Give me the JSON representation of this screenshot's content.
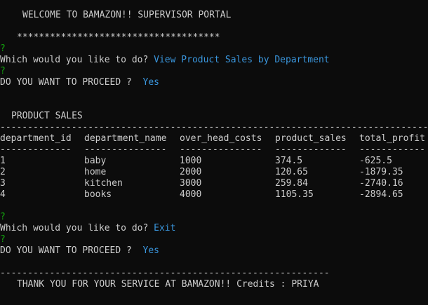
{
  "colors": {
    "background": "#0c0c0c",
    "text": "#cccccc",
    "prompt_mark": "#13a10e",
    "answer": "#3a96dd"
  },
  "header": {
    "welcome": "WELCOME TO BAMAZON!! SUPERVISOR PORTAL",
    "stars": "*************************************"
  },
  "session1": {
    "question_mark": "?",
    "question": "Which would you like to do?",
    "answer": "View Product Sales by Department",
    "proceed_mark": "?",
    "proceed_question": "DO YOU WANT TO PROCEED ?",
    "proceed_answer": "Yes"
  },
  "sales": {
    "title": "PRODUCT SALES",
    "top_separator": "--------------------------------------------------------------------------------",
    "columns": [
      "department_id",
      "department_name",
      "over_head_costs",
      "product_sales",
      "total_profit"
    ],
    "column_underlines": [
      "-------------",
      "---------------",
      "---------------",
      "-------------",
      "------------"
    ],
    "rows": [
      [
        "1",
        "baby",
        "1000",
        "374.5",
        "-625.5"
      ],
      [
        "2",
        "home",
        "2000",
        "120.65",
        "-1879.35"
      ],
      [
        "3",
        "kitchen",
        "3000",
        "259.84",
        "-2740.16"
      ],
      [
        "4",
        "books",
        "4000",
        "1105.35",
        "-2894.65"
      ]
    ]
  },
  "session2": {
    "question_mark": "?",
    "question": "Which would you like to do?",
    "answer": "Exit",
    "proceed_mark": "?",
    "proceed_question": "DO YOU WANT TO PROCEED ?",
    "proceed_answer": "Yes"
  },
  "footer": {
    "separator": "------------------------------------------------------------",
    "thanks": "THANK YOU FOR YOUR SERVICE AT BAMAZON!! Credits : PRIYA"
  }
}
